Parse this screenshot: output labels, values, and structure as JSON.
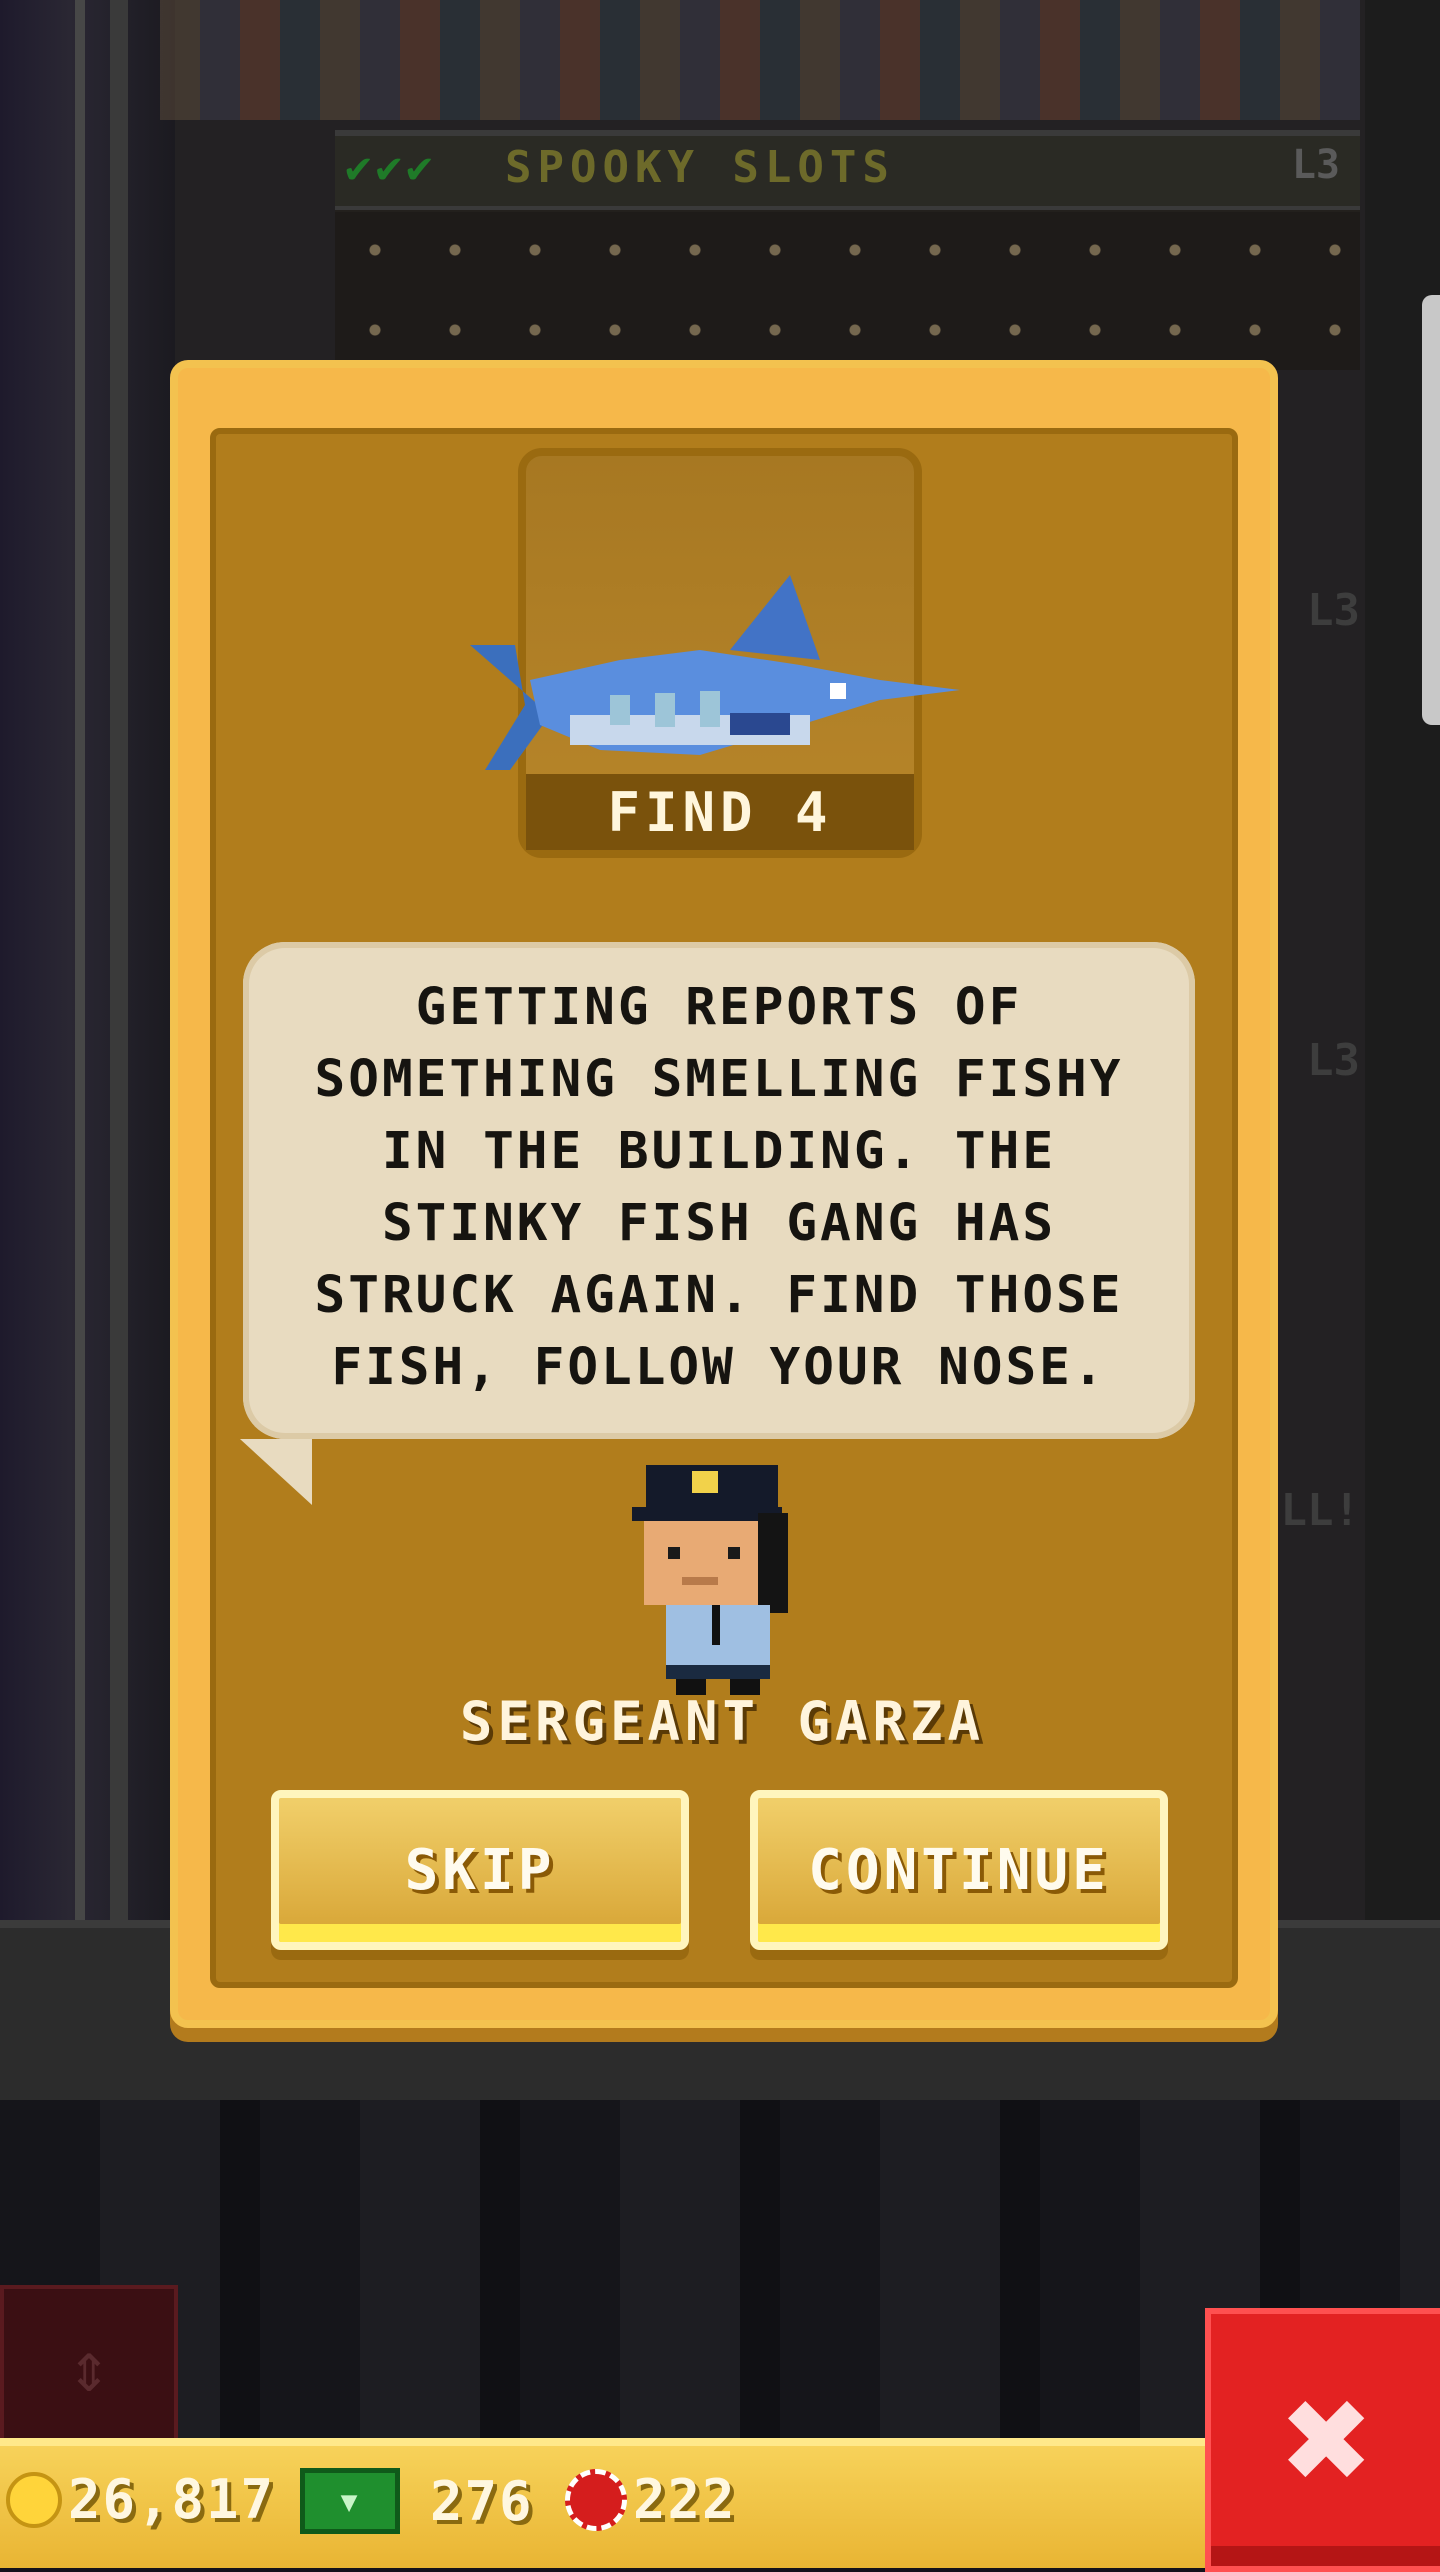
{
  "background": {
    "floor": {
      "checks": "✔✔✔",
      "name": "SPOOKY SLOTS",
      "level": "L3"
    },
    "side_levels": [
      "L3",
      "L3",
      "LL!"
    ]
  },
  "dialog": {
    "goal_caption": "FIND 4",
    "goal_icon": "swordfish-icon",
    "message": "GETTING REPORTS OF\nSOMETHING SMELLING FISHY\nIN THE BUILDING. THE\nSTINKY FISH GANG HAS\nSTRUCK AGAIN. FIND THOSE\nFISH, FOLLOW YOUR NOSE.",
    "speaker": "SERGEANT GARZA",
    "skip_label": "SKIP",
    "continue_label": "CONTINUE"
  },
  "hud": {
    "coins": "26,817",
    "bux": "276",
    "chips": "222"
  },
  "colors": {
    "dialog_gold": "#f6b84a",
    "dialog_inner": "#b17d1c",
    "bubble": "#e8dbc0",
    "close_red": "#e32222",
    "hud_gold": "#f0c24a"
  }
}
